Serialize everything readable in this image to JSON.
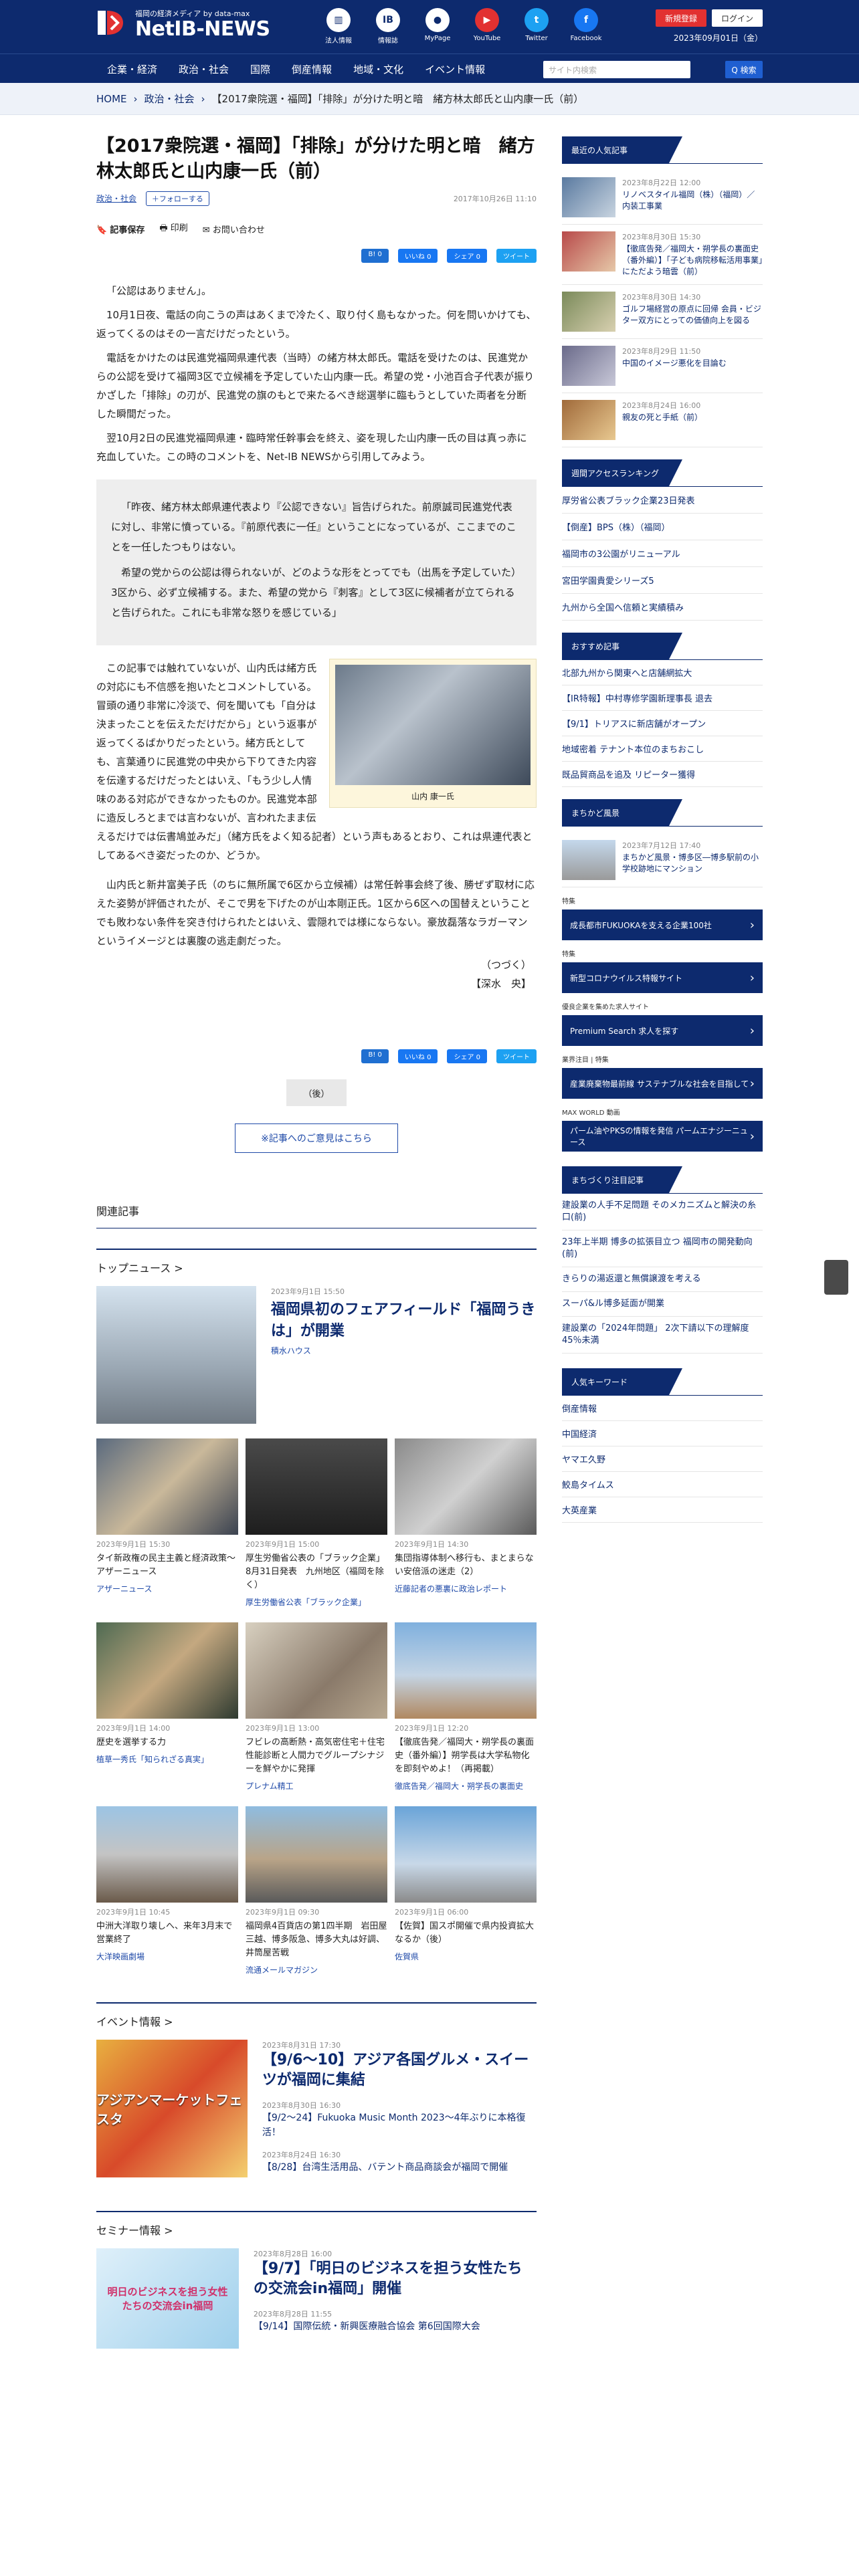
{
  "header": {
    "tagline": "福岡の経済メディア by data-max",
    "logo_text": "NetIB-NEWS",
    "icons": [
      {
        "name": "corporate-info-icon",
        "label": "法人情報"
      },
      {
        "name": "info-bulletin-icon",
        "label": "情報誌"
      },
      {
        "name": "mypage-icon",
        "label": "MyPage"
      },
      {
        "name": "youtube-icon",
        "label": "YouTube"
      },
      {
        "name": "twitter-icon",
        "label": "Twitter"
      },
      {
        "name": "facebook-icon",
        "label": "Facebook"
      }
    ],
    "register_label": "新規登録",
    "login_label": "ログイン",
    "date": "2023年09月01日（金）"
  },
  "nav": {
    "items": [
      "企業・経済",
      "政治・社会",
      "国際",
      "倒産情報",
      "地域・文化",
      "イベント情報"
    ],
    "search_placeholder": "サイト内検索",
    "search_button": "Q 検索"
  },
  "breadcrumb": [
    "HOME",
    "政治・社会",
    "【2017衆院選・福岡】「排除」が分けた明と暗　緒方林太郎氏と山内康一氏（前）"
  ],
  "article": {
    "title": "【2017衆院選・福岡】「排除」が分けた明と暗　緒方林太郎氏と山内康一氏（前）",
    "category": "政治・社会",
    "follow": "＋フォローする",
    "date": "2017年10月26日 11:10",
    "tools": [
      "記事保存",
      "印刷",
      "お問い合わせ"
    ],
    "share": [
      {
        "label": "B! 0",
        "color": "#1f6fd1"
      },
      {
        "label": "いいね 0",
        "color": "#1877f2"
      },
      {
        "label": "シェア 0",
        "color": "#1877f2"
      },
      {
        "label": "ツイート",
        "color": "#1da1f2"
      }
    ],
    "paragraphs": [
      "「公認はありません」。",
      "10月1日夜、電話の向こうの声はあくまで冷たく、取り付く島もなかった。何を問いかけても、返ってくるのはその一言だけだったという。",
      "電話をかけたのは民進党福岡県連代表（当時）の緒方林太郎氏。電話を受けたのは、民進党からの公認を受けて福岡3区で立候補を予定していた山内康一氏。希望の党・小池百合子代表が振りかざした「排除」の刃が、民進党の旗のもとで来たるべき総選挙に臨もうとしていた両者を分断した瞬間だった。",
      "翌10月2日の民進党福岡県連・臨時常任幹事会を終え、姿を現した山内康一氏の目は真っ赤に充血していた。この時のコメントを、Net-IB NEWSから引用してみよう。"
    ],
    "quote": [
      "「昨夜、緒方林太郎県連代表より『公認できない』旨告げられた。前原誠司民進党代表に対し、非常に憤っている。『前原代表に一任』ということになっているが、ここまでのことを一任したつもりはない。",
      "希望の党からの公認は得られないが、どのような形をとってでも（出馬を予定していた）3区から、必ず立候補する。また、希望の党から『刺客』として3区に候補者が立てられると告げられた。これにも非常な怒りを感じている」"
    ],
    "photo_caption": "山内 康一氏",
    "paragraphs2": [
      "この記事では触れていないが、山内氏は緒方氏の対応にも不信感を抱いたとコメントしている。冒頭の通り非常に冷淡で、何を聞いても「自分は決まったことを伝えただけだから」という返事が返ってくるばかりだったという。緒方氏としても、言葉通りに民進党の中央から下りてきた内容を伝達するだけだったとはいえ、「もう少し人情味のある対応ができなかったものか。民進党本部に造反しろとまでは言わないが、言われたまま伝えるだけでは伝書鳩並みだ」（緒方氏をよく知る記者）という声もあるとおり、これは県連代表としてあるべき姿だったのか、どうか。",
      "山内氏と新井富美子氏（のちに無所属で6区から立候補）は常任幹事会終了後、勝ぜず取材に応えた姿勢が評価されたが、そこで男を下げたのが山本剛正氏。1区から6区への国替えということでも敗わない条件を突き付けられたとはいえ、雲隠れでは様にならない。豪放磊落なラガーマンというイメージとは裏腹の逃走劇だった。"
    ],
    "continued": "（つづく）",
    "author": "【深水　央】",
    "next_label": "（後）",
    "opinion_label": "※記事へのご意見はこちら"
  },
  "related_label": "関連記事",
  "top_news": {
    "heading": "トップニュース >",
    "feature": {
      "date": "2023年9月1日 15:50",
      "title": "福岡県初のフェアフィールド「福岡うきは」が開業",
      "source": "積水ハウス"
    },
    "items": [
      {
        "date": "2023年9月1日 15:30",
        "title": "タイ新政権の民主主義と経済政策～アザーニュース",
        "source": "アザーニュース",
        "bg": "linear-gradient(135deg,#5a6a7e,#c9b89a 50%,#3a4250)"
      },
      {
        "date": "2023年9月1日 15:00",
        "title": "厚生労働省公表の「ブラック企業」　8月31日発表　九州地区（福岡を除く）",
        "source": "厚生労働省公表「ブラック企業」",
        "bg": "linear-gradient(180deg,#4a4a4a,#1e1e1e)"
      },
      {
        "date": "2023年9月1日 14:30",
        "title": "集団指導体制へ移行も、まとまらない安倍派の迷走（2）",
        "source": "近藤記者の悪裏に政治レポート",
        "bg": "linear-gradient(135deg,#8a8a8a,#d0d0d0 50%,#5a5a5a)"
      },
      {
        "date": "2023年9月1日 14:00",
        "title": "歴史を選挙する力",
        "source": "植草一秀氏「知られざる真実」",
        "bg": "linear-gradient(135deg,#4e6a52,#c4a880 50%,#2e3a30)"
      },
      {
        "date": "2023年9月1日 13:00",
        "title": "フビレの高断熱・高気密住宅＋住宅性能診断と人間力でグループシナジーを鮮やかに発揮",
        "source": "プレナム精工",
        "bg": "linear-gradient(135deg,#d8d0c0,#8a7a6a 60%,#b8a890)"
      },
      {
        "date": "2023年9月1日 12:20",
        "title": "【徹底告発／福岡大・朔学長の裏面史（番外編）】朔学長は大学私物化を即刻やめよ！（再掲載）",
        "source": "徹底告発／福岡大・朔学長の裏面史",
        "bg": "linear-gradient(180deg,#7fb0de,#c4d4e4 55%,#b08860)"
      },
      {
        "date": "2023年9月1日 10:45",
        "title": "中洲大洋取り壊しへ、来年3月末で営業終了",
        "source": "大洋映画劇場",
        "bg": "linear-gradient(180deg,#9cc4e4,#c4c4c4 50%,#6a5a4a)"
      },
      {
        "date": "2023年9月1日 09:30",
        "title": "福岡県4百貨店の第1四半期　岩田屋三越、博多阪急、博多大丸は好調、井筒屋苦戦",
        "source": "流通メールマガジン",
        "bg": "linear-gradient(180deg,#8fbce0,#b9a488 55%,#5a5a5a)"
      },
      {
        "date": "2023年9月1日 06:00",
        "title": "【佐賀】国スポ開催で県内投資拡大なるか（後）",
        "source": "佐賀県",
        "bg": "linear-gradient(180deg,#6aa4d8,#c8d8e8 60%,#8a8a8a)"
      }
    ]
  },
  "events": {
    "heading": "イベント情報 >",
    "image_title": "アジアンマーケットフェスタ",
    "items": [
      {
        "date": "2023年8月31日 17:30",
        "title": "【9/6～10】アジア各国グルメ・スイーツが福岡に集結"
      },
      {
        "date": "2023年8月30日 16:30",
        "title": "【9/2～24】Fukuoka Music Month 2023～4年ぶりに本格復活！"
      },
      {
        "date": "2023年8月24日 16:30",
        "title": "【8/28】台湾生活用品、バテント商品商談会が福岡で開催"
      }
    ]
  },
  "seminar": {
    "heading": "セミナー情報 >",
    "image_title": "明日のビジネスを担う女性たちの交流会in福岡",
    "items": [
      {
        "date": "2023年8月28日 16:00",
        "title": "【9/7】「明日のビジネスを担う女性たちの交流会in福岡」開催"
      },
      {
        "date": "2023年8月28日 11:55",
        "title": "【9/14】国際伝統・新興医療融合協会 第6回国際大会"
      }
    ]
  },
  "sidebar": {
    "recent_heading": "最近の人気記事",
    "recent": [
      {
        "date": "2023年8月22日 12:00",
        "title": "リノベスタイル福岡（株）（福岡）／内装工事業"
      },
      {
        "date": "2023年8月30日 15:30",
        "title": "【徹底告発／福岡大・朔学長の裏面史（番外編）】「子ども病院移転活用事業」にただよう暗雲（前）"
      },
      {
        "date": "2023年8月30日 14:30",
        "title": "ゴルフ場経営の原点に回帰 会員・ビジター双方にとっての価値向上を図る"
      },
      {
        "date": "2023年8月29日 11:50",
        "title": "中国のイメージ悪化を目論む"
      },
      {
        "date": "2023年8月24日 16:00",
        "title": "親友の死と手紙（前）"
      }
    ],
    "ranking_heading": "週間アクセスランキング",
    "ranking": [
      "厚労省公表ブラック企業23日発表",
      "【倒産】BPS（株）（福岡）",
      "福岡市の3公園がリニューアル",
      "宮田学園貴愛シリーズ5",
      "九州から全国へ信頼と実績積み"
    ],
    "recommend_heading": "おすすめ記事",
    "recommend": [
      "北部九州から関東へと店舗網拡大",
      "【IR特報】中村専修学園新理事長 退去",
      "【9/1】トリアスに新店舗がオープン",
      "地域密着 テナント本位のまちおこし",
      "既品貿商品を追及 リピーター獲得"
    ],
    "walk_heading": "まちかど風景",
    "walk": {
      "date": "2023年7月12日 17:40",
      "title": "まちかど風景・博多区―博多駅前の小学校跡地にマンション"
    },
    "banners": [
      {
        "label": "特集",
        "text": "成長都市FUKUOKAを支える企業100社"
      },
      {
        "label": "特集",
        "text": "新型コロナウイルス特報サイト"
      },
      {
        "label": "優良企業を集めた求人サイト",
        "text": "Premium Search 求人を探す"
      },
      {
        "label": "業界注目 | 特集",
        "text": "産業廃棄物最前線 サステナブルな社会を目指して"
      },
      {
        "label": "MAX WORLD 動画",
        "text": "パーム油やPKSの情報を発信 パームエナジーニュース"
      }
    ],
    "town_heading": "まちづくり注目記事",
    "town": [
      "建設業の人手不足問題 そのメカニズムと解決の糸口(前)",
      "23年上半期 博多の拡張目立つ 福岡市の開発動向(前)",
      "きらりの湯返還と無償譲渡を考える",
      "スーパ&ル博多延面が開業",
      "建設業の「2024年問題」 2次下請以下の理解度45％未満"
    ],
    "keyword_heading": "人気キーワード",
    "keywords": [
      "倒産情報",
      "中国経済",
      "ヤマエ久野",
      "鮫島タイムス",
      "大英産業"
    ]
  }
}
